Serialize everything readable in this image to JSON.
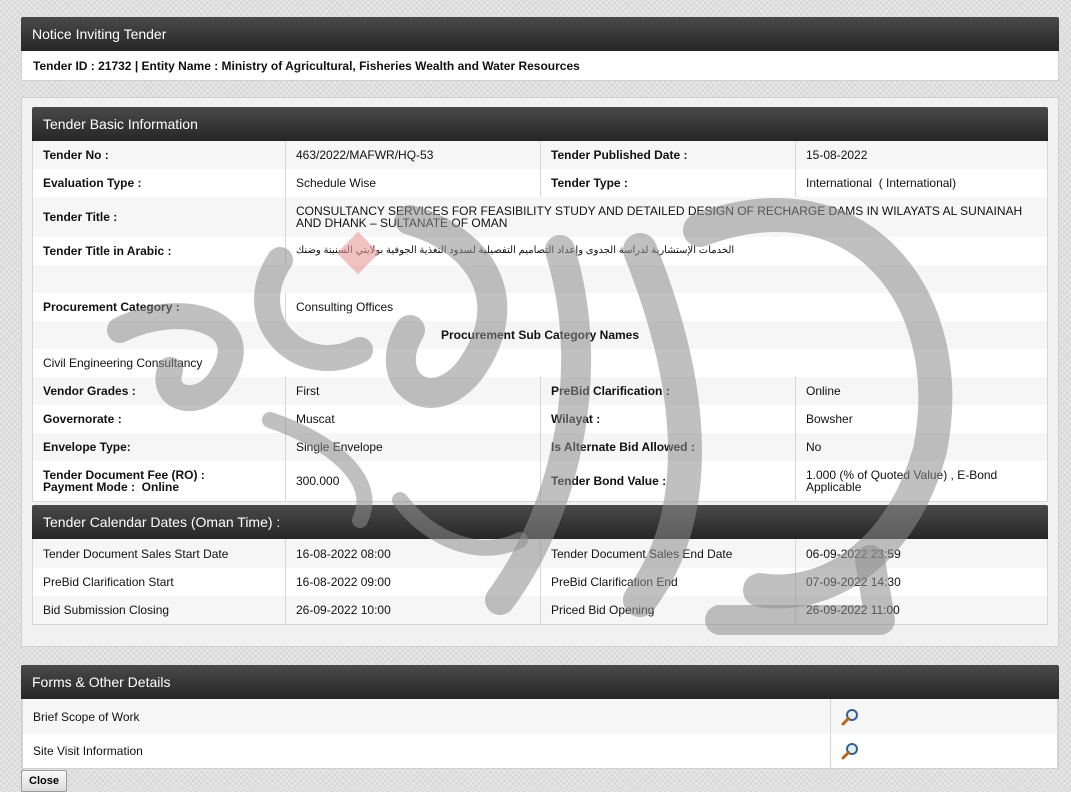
{
  "notice": {
    "title": "Notice Inviting Tender",
    "id_line": "Tender ID : 21732 | Entity Name : Ministry of Agricultural, Fisheries Wealth and Water Resources"
  },
  "basic": {
    "title": "Tender Basic Information",
    "tender_no_label": "Tender No :",
    "tender_no": "463/2022/MAFWR/HQ-53",
    "published_label": "Tender Published Date :",
    "published": "15-08-2022",
    "eval_label": "Evaluation Type :",
    "eval": "Schedule Wise",
    "type_label": "Tender Type :",
    "type": "International  ( International)",
    "title_label": "Tender Title :",
    "title_text": "CONSULTANCY SERVICES FOR FEASIBILITY STUDY AND DETAILED DESIGN OF RECHARGE DAMS IN WILAYATS AL SUNAINAH AND DHANK – SULTANATE OF OMAN",
    "arabic_label": "Tender Title in Arabic :",
    "arabic": "الخدمات الإستشارية لدراسة الجدوى وإعداد التصاميم التفصيلية لسدود التغذية الجوفية بولايتي السنينة وضنك",
    "proc_cat_label": "Procurement Category :",
    "proc_cat": "Consulting Offices",
    "sub_cat_header": "Procurement Sub Category Names",
    "sub_cat": "Civil Engineering Consultancy",
    "vendor_label": "Vendor Grades :",
    "vendor": "First",
    "prebid_label": "PreBid Clarification :",
    "prebid": "Online",
    "gov_label": "Governorate :",
    "gov": "Muscat",
    "wilayat_label": "Wilayat :",
    "wilayat": "Bowsher",
    "envelope_label": "Envelope Type:",
    "envelope": "Single Envelope",
    "alt_label": "Is Alternate Bid Allowed :",
    "alt": "No",
    "fee_label": "Tender Document Fee (RO) :",
    "payment_label": "Payment Mode :  Online",
    "fee": "300.000",
    "bond_label": "Tender Bond Value :",
    "bond": "1.000 (% of Quoted Value) , E-Bond Applicable"
  },
  "calendar": {
    "title": "Tender Calendar Dates (Oman Time) :",
    "rows": [
      {
        "l1": "Tender Document Sales Start Date",
        "v1": "16-08-2022 08:00",
        "l2": "Tender Document Sales End Date",
        "v2": "06-09-2022 23:59"
      },
      {
        "l1": "PreBid Clarification Start",
        "v1": "16-08-2022 09:00",
        "l2": "PreBid Clarification End",
        "v2": "07-09-2022 14:30"
      },
      {
        "l1": "Bid Submission Closing",
        "v1": "26-09-2022 10:00",
        "l2": "Priced Bid Opening",
        "v2": "26-09-2022 11:00"
      }
    ]
  },
  "forms": {
    "title": "Forms & Other Details",
    "items": [
      {
        "label": "Brief Scope of Work",
        "icon": "magnifier-icon"
      },
      {
        "label": "Site Visit Information",
        "icon": "magnifier-icon"
      }
    ]
  },
  "close_label": "Close",
  "watermark_text": [
    "ارتباط",
    "گستران",
    "زهره"
  ],
  "colors": {
    "header_bar": "#333333",
    "background": "#d9d9d9",
    "watermark": "#9a9a9a",
    "watermark_accent": "#e89a9a"
  }
}
